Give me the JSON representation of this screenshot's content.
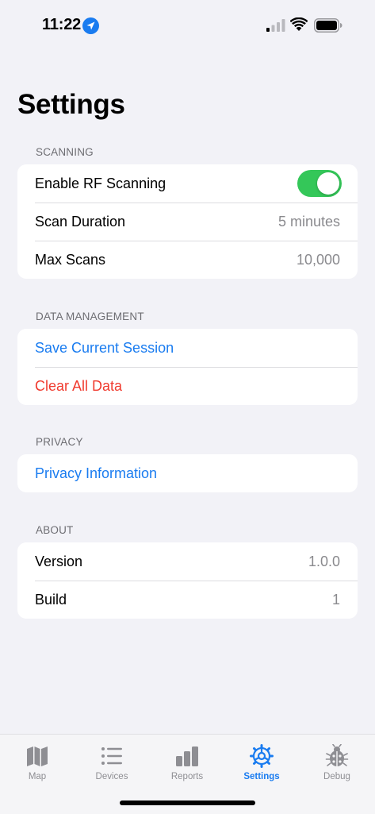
{
  "status_bar": {
    "time": "11:22"
  },
  "title": "Settings",
  "sections": {
    "scanning": {
      "header": "SCANNING",
      "enable_rf_label": "Enable RF Scanning",
      "enable_rf_on": true,
      "scan_duration_label": "Scan Duration",
      "scan_duration_value": "5 minutes",
      "max_scans_label": "Max Scans",
      "max_scans_value": "10,000"
    },
    "data_management": {
      "header": "DATA MANAGEMENT",
      "save_label": "Save Current Session",
      "clear_label": "Clear All Data"
    },
    "privacy": {
      "header": "PRIVACY",
      "info_label": "Privacy Information"
    },
    "about": {
      "header": "ABOUT",
      "version_label": "Version",
      "version_value": "1.0.0",
      "build_label": "Build",
      "build_value": "1"
    }
  },
  "tabs": [
    {
      "label": "Map",
      "icon": "map-icon"
    },
    {
      "label": "Devices",
      "icon": "list-icon"
    },
    {
      "label": "Reports",
      "icon": "bar-chart-icon"
    },
    {
      "label": "Settings",
      "icon": "gear-icon",
      "active": true
    },
    {
      "label": "Debug",
      "icon": "ladybug-icon"
    }
  ],
  "colors": {
    "accent": "#1a7cf0",
    "destructive": "#f03a2e",
    "toggle_on": "#34c759",
    "background": "#f2f2f7"
  }
}
